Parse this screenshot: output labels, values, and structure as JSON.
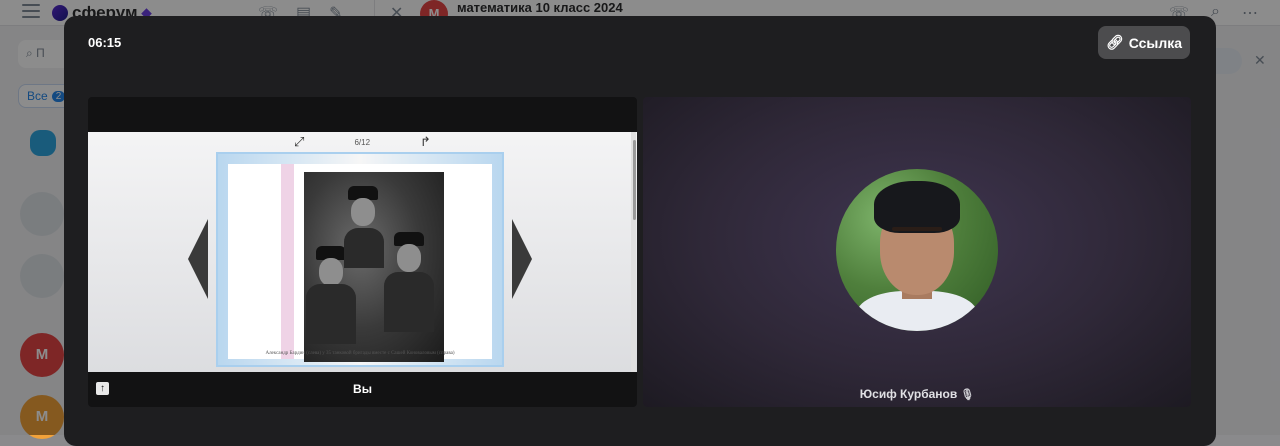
{
  "background": {
    "app_name": "сферум",
    "chat_title": "математика 10 класс 2024",
    "chat_avatar_letter": "М",
    "search_placeholder": "П",
    "filter_label": "Все",
    "filter_count": "2",
    "list_avatar_letters": [
      "М",
      "М"
    ],
    "right_pill_label": "и"
  },
  "call": {
    "timer": "06:15",
    "link_button_label": "Ссылка",
    "self_tile_label": "Вы",
    "participant_name": "Юсиф Курбанов",
    "screen_share": {
      "page_counter": "6/12",
      "caption": "Александр Бардин (слева) у 35 танковой бригады вместе с Сашей Коноваловым (справа)"
    }
  }
}
